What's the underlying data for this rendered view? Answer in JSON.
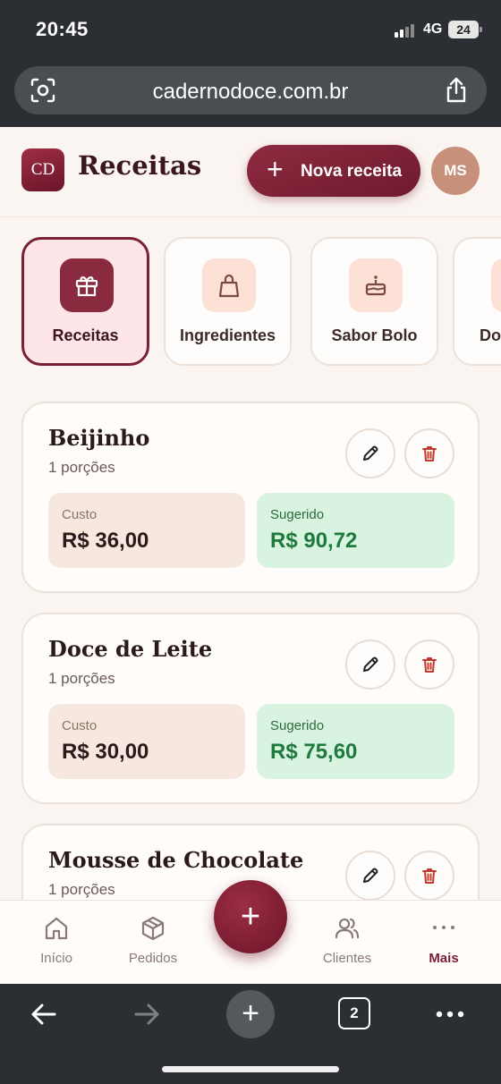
{
  "status_bar": {
    "time": "20:45",
    "network": "4G",
    "battery": "24"
  },
  "browser": {
    "url": "cadernodoce.com.br",
    "tab_count": "2"
  },
  "header": {
    "logo": "CD",
    "title": "Receitas",
    "new_button": "Nova receita",
    "avatar": "MS"
  },
  "categories": [
    {
      "label": "Receitas",
      "icon": "gift-icon",
      "active": true
    },
    {
      "label": "Ingredientes",
      "icon": "shopping-bag-icon",
      "active": false
    },
    {
      "label": "Sabor Bolo",
      "icon": "cake-icon",
      "active": false
    },
    {
      "label": "Do",
      "icon": "tag-icon",
      "active": false
    }
  ],
  "recipes": [
    {
      "name": "Beijinho",
      "portions": "1 porções",
      "cost_label": "Custo",
      "cost": "R$ 36,00",
      "suggested_label": "Sugerido",
      "suggested": "R$ 90,72"
    },
    {
      "name": "Doce de Leite",
      "portions": "1 porções",
      "cost_label": "Custo",
      "cost": "R$ 30,00",
      "suggested_label": "Sugerido",
      "suggested": "R$ 75,60"
    },
    {
      "name": "Mousse de Chocolate",
      "portions": "1 porções"
    }
  ],
  "bottom_nav": [
    {
      "label": "Início",
      "icon": "home-icon",
      "active": false
    },
    {
      "label": "Pedidos",
      "icon": "box-icon",
      "active": false
    },
    {
      "label": "Clientes",
      "icon": "users-icon",
      "active": false
    },
    {
      "label": "Mais",
      "icon": "more-icon",
      "active": true
    }
  ],
  "fab": "+",
  "colors": {
    "accent": "#7a1e35",
    "background": "#fbf5f1",
    "suggested_bg": "#d8f3df",
    "cost_bg": "#f6e8df"
  }
}
